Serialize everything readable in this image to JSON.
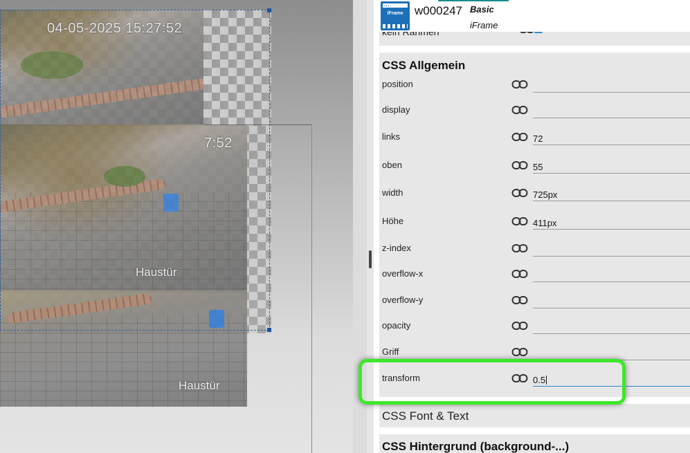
{
  "canvas": {
    "timestamp_main": "04-05-2025 15:27:52",
    "timestamp_overlap": "7:52",
    "camera_label_1": "Haustür",
    "camera_label_2": "Haustür"
  },
  "widget": {
    "id": "w000247",
    "set": "Basic",
    "type": "iFrame",
    "icon_label": "iFrame",
    "icon": "iframe-widget-icon",
    "accent_color": "#1d6fb8"
  },
  "partial_row": {
    "label": "kein Rahmen"
  },
  "css_general": {
    "title": "CSS Allgemein",
    "rows": [
      {
        "name": "position",
        "value": ""
      },
      {
        "name": "display",
        "value": ""
      },
      {
        "name": "links",
        "value": "72"
      },
      {
        "name": "oben",
        "value": "55"
      },
      {
        "name": "width",
        "value": "725px"
      },
      {
        "name": "Höhe",
        "value": "411px"
      },
      {
        "name": "z-index",
        "value": ""
      },
      {
        "name": "overflow-x",
        "value": ""
      },
      {
        "name": "overflow-y",
        "value": ""
      },
      {
        "name": "opacity",
        "value": ""
      },
      {
        "name": "Griff",
        "value": ""
      },
      {
        "name": "transform",
        "value": "0.5"
      }
    ]
  },
  "css_font": {
    "title": "CSS Font & Text"
  },
  "css_background": {
    "title": "CSS Hintergrund (background-...)"
  },
  "highlight_color": "#3ee82a"
}
